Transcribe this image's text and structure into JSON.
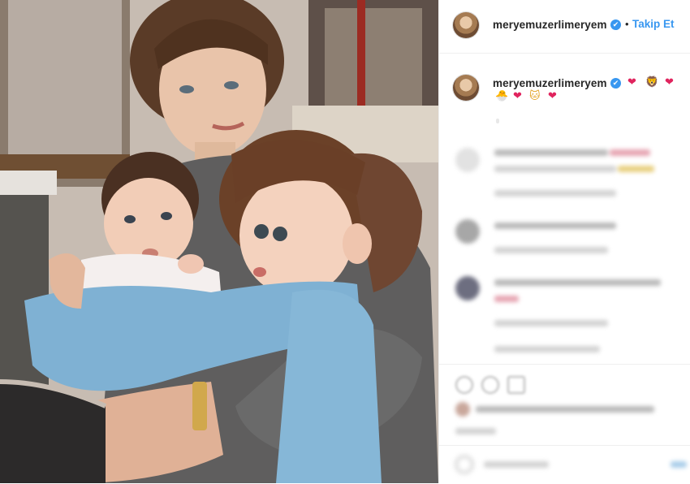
{
  "post": {
    "username": "meryemuzerlimeryem",
    "verified_mark": "✔",
    "separator": "•",
    "follow_label": "Takip Et"
  },
  "caption": {
    "username": "meryemuzerlimeryem",
    "verified_mark": "✔",
    "emojis_line1": [
      "❤",
      "🦁",
      "❤"
    ],
    "emojis_line2": [
      "🐣",
      "❤",
      "🐱",
      "❤"
    ]
  },
  "icons": {
    "like": "heart-icon",
    "comment": "comment-icon",
    "share": "share-icon"
  },
  "colors": {
    "link_blue": "#3897f0",
    "text": "#262626",
    "heart_red": "#e0245e",
    "border": "#efefef"
  }
}
